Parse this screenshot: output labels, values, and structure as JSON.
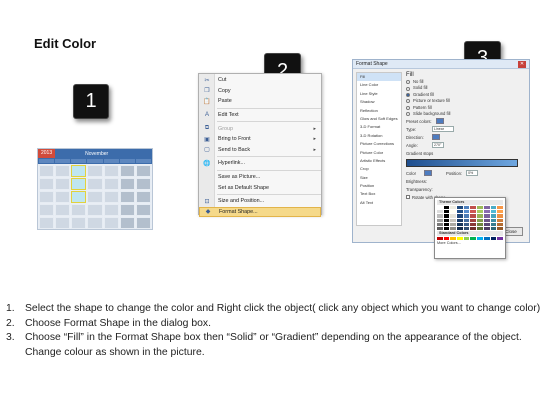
{
  "title": "Edit Color",
  "step_badges": [
    "1",
    "2",
    "3"
  ],
  "calendar": {
    "year": "2013",
    "month": "November"
  },
  "context_menu": {
    "items": [
      {
        "icon": "scissors-icon",
        "glyph": "✂",
        "label": "Cut",
        "disabled": false
      },
      {
        "icon": "copy-icon",
        "glyph": "❐",
        "label": "Copy",
        "disabled": false
      },
      {
        "icon": "paste-icon",
        "glyph": "📋",
        "label": "Paste",
        "disabled": false
      },
      {
        "icon": "edit-text-icon",
        "glyph": "A",
        "label": "Edit Text",
        "disabled": false
      },
      {
        "icon": "group-icon",
        "glyph": "⧉",
        "label": "Group",
        "disabled": true,
        "submenu": true
      },
      {
        "icon": "bring-front-icon",
        "glyph": "▣",
        "label": "Bring to Front",
        "disabled": false,
        "submenu": true
      },
      {
        "icon": "send-back-icon",
        "glyph": "▢",
        "label": "Send to Back",
        "disabled": false,
        "submenu": true
      },
      {
        "icon": "hyperlink-icon",
        "glyph": "🌐",
        "label": "Hyperlink...",
        "disabled": false
      },
      {
        "icon": "",
        "glyph": "",
        "label": "Save as Picture...",
        "disabled": false
      },
      {
        "icon": "",
        "glyph": "",
        "label": "Set as Default Shape",
        "disabled": false
      },
      {
        "icon": "size-icon",
        "glyph": "⊡",
        "label": "Size and Position...",
        "disabled": false
      },
      {
        "icon": "format-shape-icon",
        "glyph": "◆",
        "label": "Format Shape...",
        "disabled": false,
        "active": true
      }
    ]
  },
  "dialog": {
    "title": "Format Shape",
    "categories": [
      "Fill",
      "Line Color",
      "Line Style",
      "Shadow",
      "Reflection",
      "Glow and Soft Edges",
      "3-D Format",
      "3-D Rotation",
      "Picture Corrections",
      "Picture Color",
      "Artistic Effects",
      "Crop",
      "Size",
      "Position",
      "Text Box",
      "Alt Text"
    ],
    "pane_heading": "Fill",
    "fill_options": [
      {
        "label": "No fill",
        "selected": false
      },
      {
        "label": "Solid fill",
        "selected": false
      },
      {
        "label": "Gradient fill",
        "selected": true
      },
      {
        "label": "Picture or texture fill",
        "selected": false
      },
      {
        "label": "Pattern fill",
        "selected": false
      },
      {
        "label": "Slide background fill",
        "selected": false
      }
    ],
    "fields": {
      "preset_label": "Preset colors:",
      "type_label": "Type:",
      "type_value": "Linear",
      "direction_label": "Direction:",
      "angle_label": "Angle:",
      "angle_value": "270°",
      "gradient_stops_label": "Gradient stops",
      "color_label": "Color",
      "position_label": "Position:",
      "position_value": "0%",
      "brightness_label": "Brightness:",
      "transparency_label": "Transparency:",
      "rotate_label": "Rotate with shape"
    },
    "close_label": "Close",
    "palette": {
      "theme_heading": "Theme Colors",
      "standard_heading": "Standard Colors",
      "more_label": "More Colors...",
      "theme_colors": [
        "#ffffff",
        "#000000",
        "#eeece1",
        "#1f497d",
        "#4f81bd",
        "#c0504d",
        "#9bbb59",
        "#8064a2",
        "#4bacc6",
        "#f79646"
      ],
      "standard_colors": [
        "#c00000",
        "#ff0000",
        "#ffc000",
        "#ffff00",
        "#92d050",
        "#00b050",
        "#00b0f0",
        "#0070c0",
        "#002060",
        "#7030a0"
      ]
    }
  },
  "instructions": [
    {
      "n": "1.",
      "text": "Select the shape to change the color and Right click the object( click any object which you want to change color)"
    },
    {
      "n": "2.",
      "text": "Choose Format Shape in the dialog box."
    },
    {
      "n": "3.",
      "text": "Choose “Fill” in the Format Shape box then “Solid” or “Gradient” depending on the appearance of the object. Change colour as shown in the picture."
    }
  ]
}
